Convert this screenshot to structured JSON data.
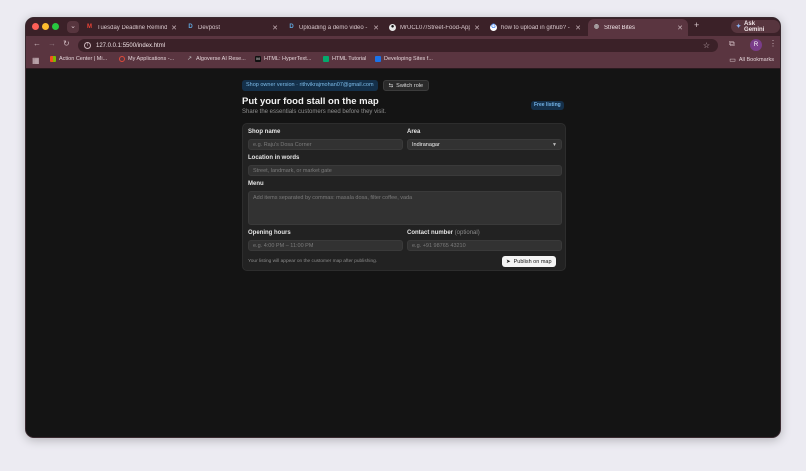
{
  "browser": {
    "tabs": [
      {
        "title": "Tuesday Deadline Reminder |",
        "icon": "gmail-icon",
        "color": "#d93025",
        "glyph": "M",
        "active": false
      },
      {
        "title": "Devpost",
        "icon": "devpost-icon",
        "color": "#1f5a8a",
        "glyph": "D",
        "active": false
      },
      {
        "title": "Uploading a demo video - D",
        "icon": "devpost-icon",
        "color": "#1f5a8a",
        "glyph": "D",
        "active": false
      },
      {
        "title": "MrUCL07/Street-Food-App",
        "icon": "github-icon",
        "color": "#444",
        "glyph": "G",
        "active": false
      },
      {
        "title": "how to upload in github? - G",
        "icon": "google-icon",
        "color": "#4285f4",
        "glyph": "G",
        "active": false
      },
      {
        "title": "Street Bites",
        "icon": "globe-icon",
        "color": "#666",
        "glyph": "◍",
        "active": true
      }
    ],
    "ask_gemini": "Ask Gemini",
    "url": "127.0.0.1:5500/index.html",
    "profile_initial": "R",
    "bookmarks": [
      {
        "label": "Action Center | Mi...",
        "color": "#f25022"
      },
      {
        "label": "My Applications -...",
        "color": "#cc2a2a"
      },
      {
        "label": "Algoverse AI Rese...",
        "color": "#888"
      },
      {
        "label": "HTML: HyperText...",
        "color": "#444"
      },
      {
        "label": "HTML Tutorial",
        "color": "#04aa6d"
      },
      {
        "label": "Developing Sites f...",
        "color": "#1a73e8"
      }
    ],
    "all_bookmarks": "All Bookmarks"
  },
  "page": {
    "role_chip": "Shop owner version · rithvikrajmohan07@gmail.com",
    "switch_role": "Switch role",
    "title": "Put your food stall on the map",
    "subtitle": "Share the essentials customers need before they visit.",
    "badge": "Free listing",
    "form": {
      "shop_name_label": "Shop name",
      "shop_name_placeholder": "e.g. Raju's Dosa Corner",
      "area_label": "Area",
      "area_value": "Indiranagar",
      "location_label": "Location in words",
      "location_placeholder": "Street, landmark, or market gate",
      "menu_label": "Menu",
      "menu_placeholder": "Add items separated by commas: masala dosa, filter coffee, vada",
      "hours_label": "Opening hours",
      "hours_placeholder": "e.g. 4:00 PM – 11:00 PM",
      "contact_label": "Contact number",
      "contact_optional": "(optional)",
      "contact_placeholder": "e.g. +91 98765 43210",
      "note": "Your listing will appear on the customer map after publishing.",
      "publish": "Publish on map"
    }
  }
}
